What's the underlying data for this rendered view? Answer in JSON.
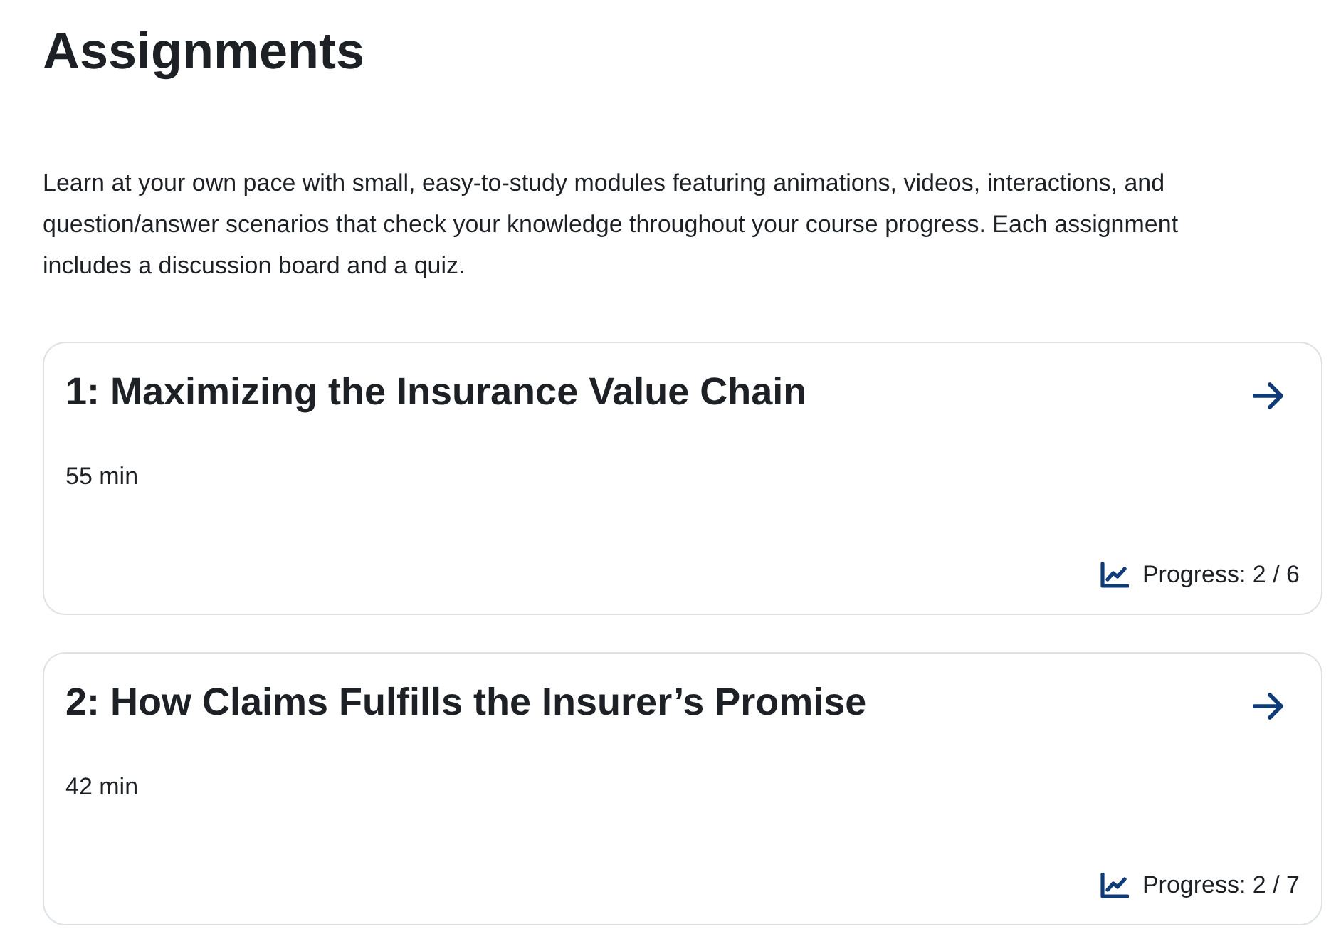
{
  "page": {
    "title": "Assignments",
    "intro": "Learn at your own pace with small, easy-to-study modules featuring animations, videos, interactions, and question/answer scenarios that check your knowledge throughout your course progress. Each assignment includes a discussion board and a quiz."
  },
  "assignments": [
    {
      "title": "1: Maximizing the Insurance Value Chain",
      "duration": "55 min",
      "progress": "Progress: 2 / 6"
    },
    {
      "title": "2: How Claims Fulfills the Insurer’s Promise",
      "duration": "42 min",
      "progress": "Progress: 2 / 7"
    }
  ]
}
